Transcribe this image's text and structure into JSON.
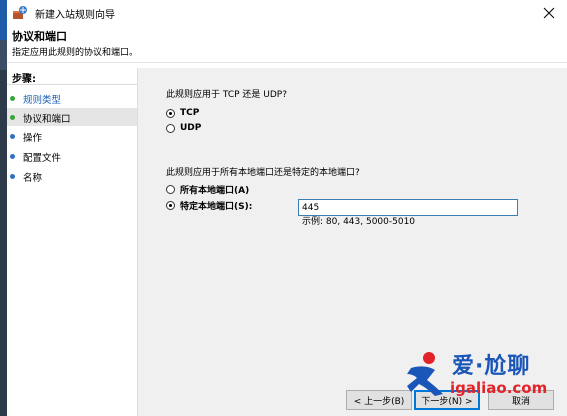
{
  "window": {
    "title": "新建入站规则向导"
  },
  "header": {
    "title": "协议和端口",
    "subtitle": "指定应用此规则的协议和端口。"
  },
  "nav": {
    "heading": "步骤:",
    "items": [
      {
        "label": "规则类型",
        "active": false,
        "link": true,
        "dot_color": "#3aa33a"
      },
      {
        "label": "协议和端口",
        "active": true,
        "link": false,
        "dot_color": "#3aa33a"
      },
      {
        "label": "操作",
        "active": false,
        "link": false,
        "dot_color": "#2f6fc4"
      },
      {
        "label": "配置文件",
        "active": false,
        "link": false,
        "dot_color": "#2f6fc4"
      },
      {
        "label": "名称",
        "active": false,
        "link": false,
        "dot_color": "#2f6fc4"
      }
    ]
  },
  "main": {
    "protocol_question": "此规则应用于 TCP 还是 UDP?",
    "protocol_options": [
      {
        "label": "TCP",
        "selected": true
      },
      {
        "label": "UDP",
        "selected": false
      }
    ],
    "port_question": "此规则应用于所有本地端口还是特定的本地端口?",
    "port_options": [
      {
        "label": "所有本地端口(A)",
        "selected": false
      },
      {
        "label": "特定本地端口(S):",
        "selected": true
      }
    ],
    "port_value": "445",
    "port_example": "示例: 80, 443, 5000-5010"
  },
  "buttons": {
    "back": "< 上一步(B)",
    "next": "下一步(N) >",
    "cancel": "取消"
  },
  "watermark": {
    "main": "爱·尬聊",
    "sub": "igaliao.com"
  },
  "colors": {
    "link": "#1a5fb4",
    "accent": "#0078d7"
  }
}
